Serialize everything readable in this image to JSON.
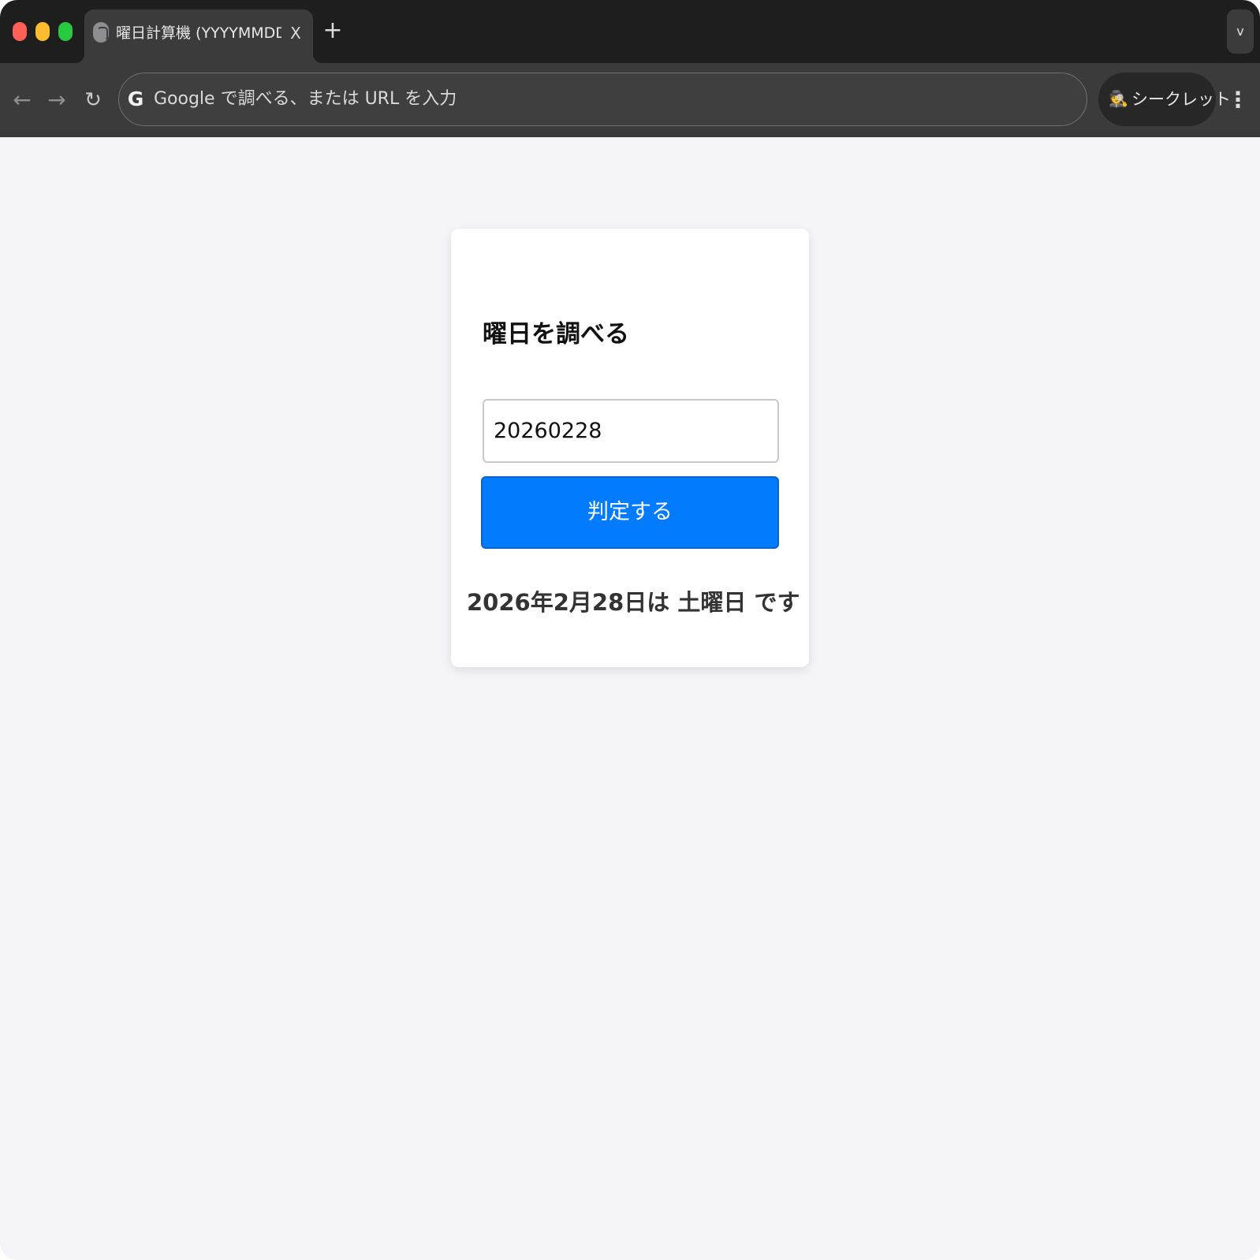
{
  "browser": {
    "tab": {
      "title": "曜日計算機 (YYYYMMDD)",
      "close_glyph": "X",
      "favicon": "globe-icon"
    },
    "new_tab_glyph": "+",
    "tab_search_glyph": "v",
    "nav": {
      "back_glyph": "←",
      "forward_glyph": "→",
      "reload_glyph": "↻"
    },
    "omnibox": {
      "google_glyph": "G",
      "placeholder": "Google で調べる、または URL を入力"
    },
    "incognito": {
      "icon": "incognito-icon",
      "icon_glyph": "🕵",
      "label": "シークレット"
    },
    "menu_glyph": "⋮"
  },
  "page": {
    "title": "曜日を調べる",
    "date_input": {
      "value": "20260228"
    },
    "judge_button_label": "判定する",
    "result_text": "2026年2月28日は 土曜日 です"
  },
  "colors": {
    "accent_button": "#027bff",
    "page_background": "#f5f5f9",
    "card_background": "#ffffff",
    "tabstrip": "#1e1e1f",
    "toolbar": "#3b3b3c"
  }
}
